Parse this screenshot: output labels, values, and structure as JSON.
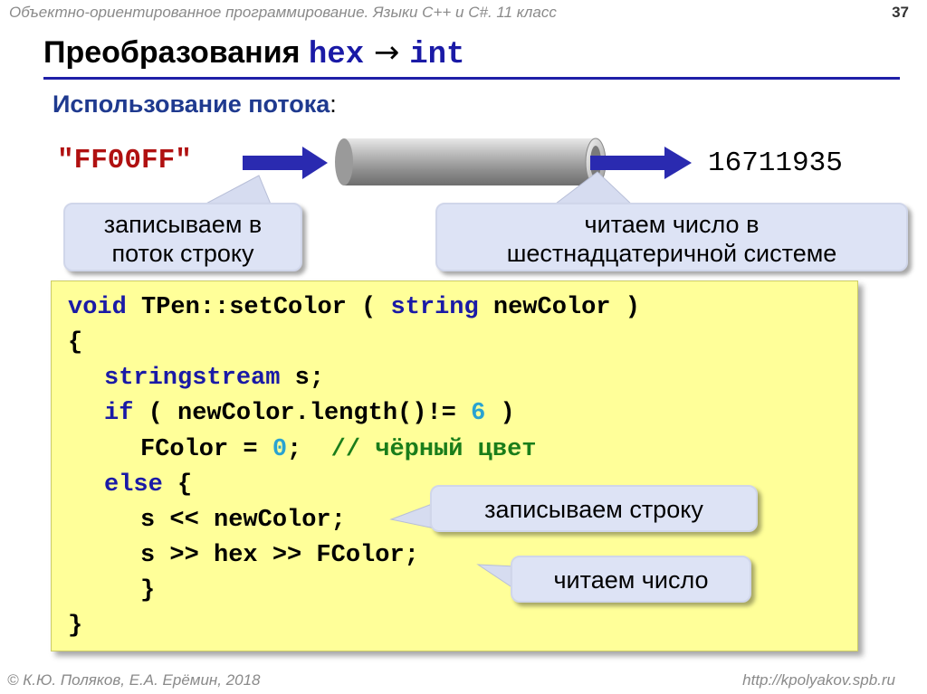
{
  "header": {
    "course": "Объектно-ориентированное программирование. Языки C++ и C#. 11 класс",
    "page_number": "37"
  },
  "title": {
    "text": "Преобразования ",
    "code_from": "hex",
    "arrow": " → ",
    "code_to": "int"
  },
  "subtitle": {
    "text": "Использование потока",
    "colon": ":"
  },
  "diagram": {
    "input_string": "\"FF00FF\"",
    "output_value": "16711935",
    "callout_write": [
      "записываем в",
      "поток строку"
    ],
    "callout_read": [
      "читаем число в",
      "шестнадцатеричной системе"
    ],
    "arrow_color": "#2a2ab0",
    "pipe_icon": "stream-pipe-icon"
  },
  "code": {
    "l1": {
      "kw": "void",
      "rest": " TPen::setColor ( ",
      "kw2": "string",
      "rest2": " newColor )"
    },
    "l2": "{",
    "l3": {
      "kw": "stringstream",
      "rest": " s;"
    },
    "l4": {
      "kw": "if",
      "rest": " ( newColor.length()!= ",
      "num": "6",
      "rest2": " )"
    },
    "l5": {
      "rest": "FColor = ",
      "num": "0",
      "rest2": ";  ",
      "cmt": "// чёрный цвет"
    },
    "l6": {
      "kw": "else",
      "rest": " {"
    },
    "l7": "s << newColor;",
    "l8": "s >> hex >> FColor;",
    "l9": "}",
    "l10": "}"
  },
  "callouts": {
    "write_string": "записываем строку",
    "read_number": "читаем число"
  },
  "footer": {
    "authors": "© К.Ю. Поляков, Е.А. Ерёмин, 2018",
    "url": "http://kpolyakov.spb.ru"
  }
}
